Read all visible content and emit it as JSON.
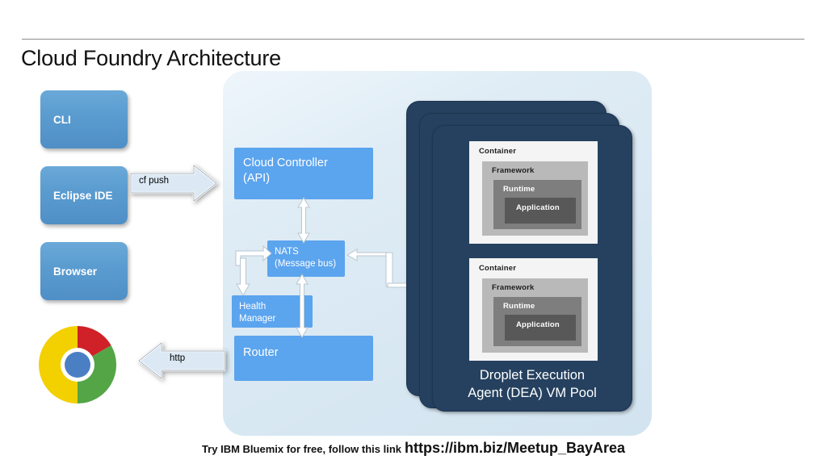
{
  "page": {
    "title": "Cloud Foundry Architecture"
  },
  "clients": [
    {
      "name": "cli",
      "label": "CLI"
    },
    {
      "name": "eclipse",
      "label": "Eclipse IDE"
    },
    {
      "name": "browser",
      "label": "Browser"
    }
  ],
  "browser_logo": {
    "name": "chrome-logo",
    "colors": {
      "red": "#cf2127",
      "yellow": "#f3d000",
      "green": "#53a546",
      "blue": "#4b7fc4",
      "ring": "#ffffff"
    }
  },
  "flows": [
    {
      "name": "cf-push",
      "label": "cf push",
      "direction": "right"
    },
    {
      "name": "http",
      "label": "http",
      "direction": "left"
    }
  ],
  "cf_components": [
    {
      "name": "cloud-controller",
      "label": "Cloud Controller\n(API)",
      "line1": "Cloud Controller",
      "line2": "(API)"
    },
    {
      "name": "nats",
      "label": "NATS (Message bus)",
      "line1": "NATS",
      "line2": "(Message bus)"
    },
    {
      "name": "health-manager",
      "label": "Health Manager",
      "line1": "Health",
      "line2": "Manager"
    },
    {
      "name": "router",
      "label": "Router",
      "line1": "Router",
      "line2": ""
    }
  ],
  "dea": {
    "label_line1": "Droplet Execution",
    "label_line2": "Agent (DEA)  VM Pool",
    "card_count": 3,
    "containers": [
      {
        "container": "Container",
        "framework": "Framework",
        "runtime": "Runtime",
        "application": "Application"
      },
      {
        "container": "Container",
        "framework": "Framework",
        "runtime": "Runtime",
        "application": "Application"
      }
    ]
  },
  "footer": {
    "text": "Try IBM Bluemix for free, follow this link",
    "link": "https://ibm.biz/Meetup_BayArea"
  },
  "colors": {
    "panel_bg": "#dce9f2",
    "client_blue": "#5b9cd0",
    "component_blue": "#5ba4ee",
    "dea_navy": "#25415f",
    "container_gray": "#f4f4f4",
    "framework_gray": "#b9b9b9",
    "runtime_gray": "#7e7e7e",
    "application_gray": "#585858"
  }
}
